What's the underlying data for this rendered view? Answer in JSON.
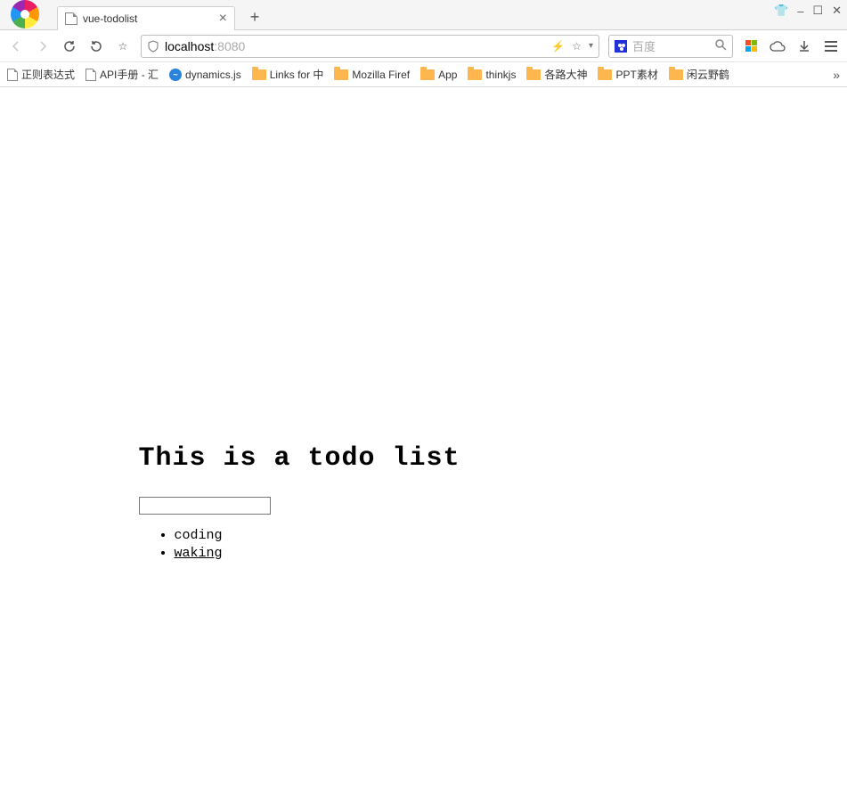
{
  "window": {
    "tab_title": "vue-todolist",
    "controls": {
      "minimize": "–",
      "maximize": "☐",
      "close": "✕"
    }
  },
  "toolbar": {
    "url_host": "localhost",
    "url_port": ":8080",
    "search_placeholder": "百度"
  },
  "bookmarks": {
    "items": [
      {
        "label": "正则表达式",
        "type": "page"
      },
      {
        "label": "API手册 - 汇",
        "type": "page"
      },
      {
        "label": "dynamics.js",
        "type": "circle"
      },
      {
        "label": "Links for 中",
        "type": "folder"
      },
      {
        "label": "Mozilla Firef",
        "type": "folder"
      },
      {
        "label": "App",
        "type": "folder"
      },
      {
        "label": "thinkjs",
        "type": "folder"
      },
      {
        "label": "各路大神",
        "type": "folder"
      },
      {
        "label": "PPT素材",
        "type": "folder"
      },
      {
        "label": "闲云野鹤",
        "type": "folder"
      }
    ],
    "more": "»"
  },
  "page": {
    "heading": "This is a todo list",
    "input_value": "",
    "todos": [
      "coding",
      "waking"
    ]
  }
}
